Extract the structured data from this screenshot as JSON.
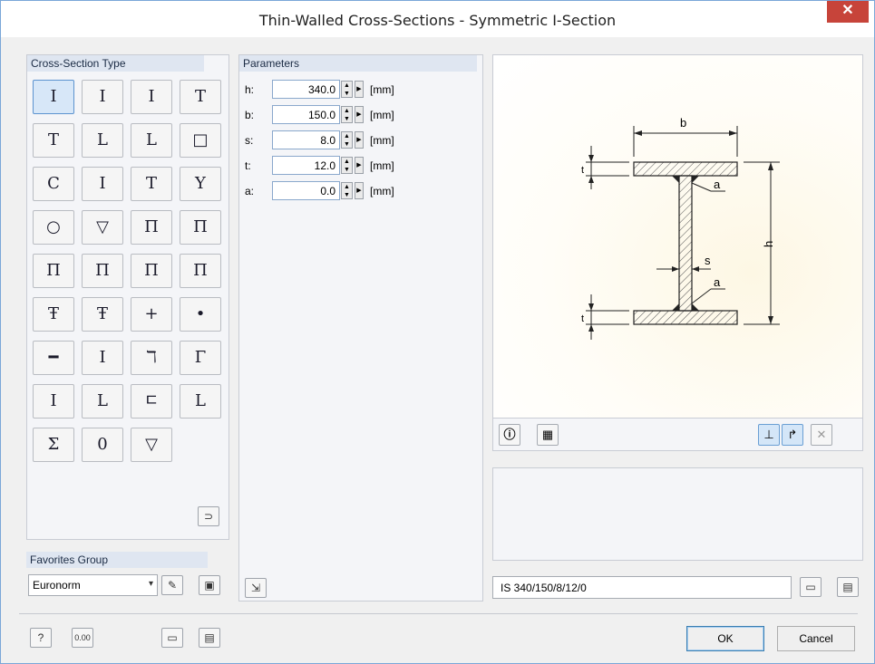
{
  "window": {
    "title": "Thin-Walled Cross-Sections - Symmetric I-Section",
    "close_label": "✕"
  },
  "cross_section_type": {
    "header": "Cross-Section Type",
    "buttons": [
      {
        "glyph": "I",
        "icon": "symmetric-i-section-icon",
        "selected": true
      },
      {
        "glyph": "I",
        "icon": "asymmetric-i-section-icon"
      },
      {
        "glyph": "I",
        "icon": "i-section-unequal-flanges-icon"
      },
      {
        "glyph": "T",
        "icon": "t-section-icon"
      },
      {
        "glyph": "T",
        "icon": "t-section-thin-icon"
      },
      {
        "glyph": "L",
        "icon": "angle-equal-icon"
      },
      {
        "glyph": "L",
        "icon": "angle-unequal-icon"
      },
      {
        "glyph": "□",
        "icon": "rectangular-hollow-icon"
      },
      {
        "glyph": "C",
        "icon": "channel-section-icon"
      },
      {
        "glyph": "I",
        "icon": "i-section-lipped-icon"
      },
      {
        "glyph": "T",
        "icon": "t-section-lipped-icon"
      },
      {
        "glyph": "Y",
        "icon": "y-section-icon"
      },
      {
        "glyph": "○",
        "icon": "circular-hollow-icon"
      },
      {
        "glyph": "▽",
        "icon": "triangular-hollow-icon"
      },
      {
        "glyph": "Π",
        "icon": "double-web-section-icon"
      },
      {
        "glyph": "Π",
        "icon": "double-web-flanged-icon"
      },
      {
        "glyph": "Π",
        "icon": "box-girder-icon"
      },
      {
        "glyph": "Π",
        "icon": "box-girder-sloped-icon"
      },
      {
        "glyph": "Π",
        "icon": "pi-section-icon"
      },
      {
        "glyph": "Π",
        "icon": "pi-section-flanged-icon"
      },
      {
        "glyph": "Ŧ",
        "icon": "i-section-stiffened-icon"
      },
      {
        "glyph": "Ŧ",
        "icon": "t-section-stiffened-icon"
      },
      {
        "glyph": "+",
        "icon": "cross-section-icon"
      },
      {
        "glyph": "•",
        "icon": "point-section-icon"
      },
      {
        "glyph": "━",
        "icon": "flat-plate-icon"
      },
      {
        "glyph": "I",
        "icon": "i-section-haunched-icon"
      },
      {
        "glyph": "ℸ",
        "icon": "z-section-icon"
      },
      {
        "glyph": "Γ",
        "icon": "sigma-z-section-icon"
      },
      {
        "glyph": "I",
        "icon": "i-section-serif-icon"
      },
      {
        "glyph": "L",
        "icon": "c-section-lipped-icon"
      },
      {
        "glyph": "ㄷ",
        "icon": "c-section-returned-lip-icon"
      },
      {
        "glyph": "L",
        "icon": "l-section-lipped-icon"
      },
      {
        "glyph": "Σ",
        "icon": "sigma-section-icon"
      },
      {
        "glyph": "0",
        "icon": "oval-hollow-icon"
      },
      {
        "glyph": "▽",
        "icon": "triangle-section-icon"
      }
    ]
  },
  "parameters": {
    "header": "Parameters",
    "rows": [
      {
        "label": "h:",
        "value": "340.0",
        "unit": "[mm]"
      },
      {
        "label": "b:",
        "value": "150.0",
        "unit": "[mm]"
      },
      {
        "label": "s:",
        "value": "8.0",
        "unit": "[mm]"
      },
      {
        "label": "t:",
        "value": "12.0",
        "unit": "[mm]"
      },
      {
        "label": "a:",
        "value": "0.0",
        "unit": "[mm]"
      }
    ]
  },
  "favorites": {
    "header": "Favorites Group",
    "selected": "Euronorm"
  },
  "drawing_labels": {
    "b": "b",
    "h": "h",
    "s": "s",
    "t": "t",
    "a": "a"
  },
  "section_name": "IS 340/150/8/12/0",
  "buttons": {
    "ok": "OK",
    "cancel": "Cancel"
  }
}
